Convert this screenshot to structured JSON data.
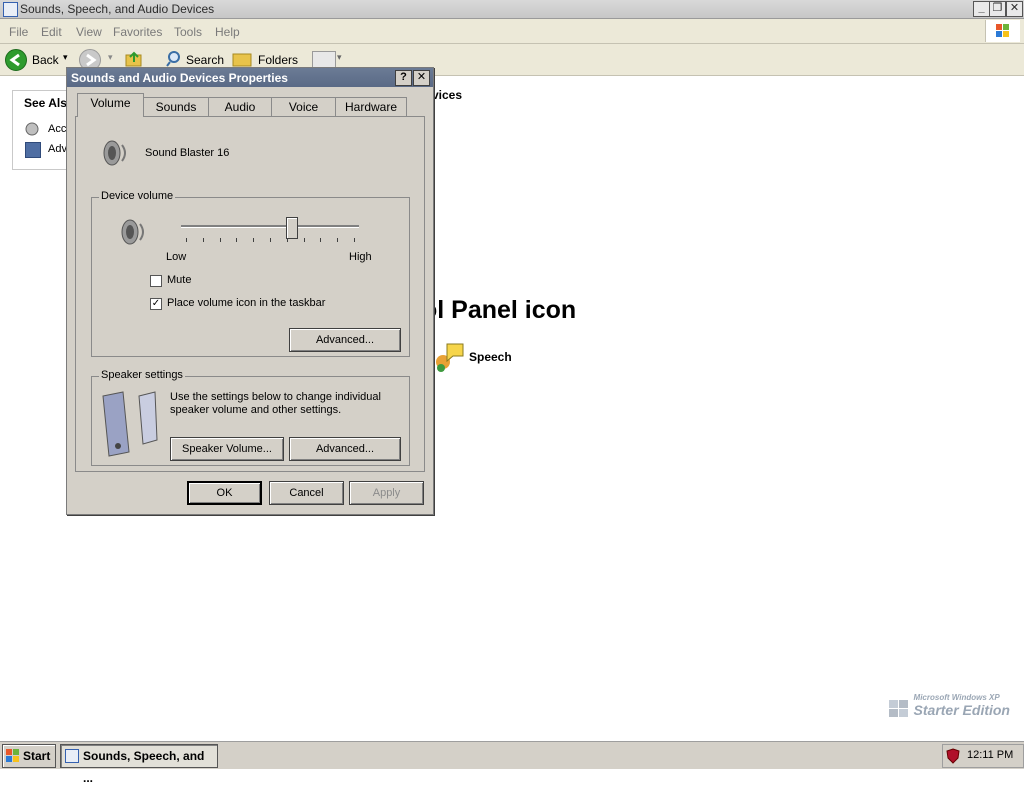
{
  "window": {
    "title": "Sounds, Speech, and Audio Devices",
    "controls": {
      "minimize": "_",
      "restore": "❐",
      "close": "✕"
    }
  },
  "menubar": [
    "File",
    "Edit",
    "View",
    "Favorites",
    "Tools",
    "Help"
  ],
  "toolbar": {
    "back": "Back",
    "search": "Search",
    "folders": "Folders"
  },
  "seealso": {
    "heading": "See Als",
    "items": [
      "Acc",
      "Adv"
    ]
  },
  "content": {
    "heading_fragment": "vices",
    "panel_icon_heading": "ol Panel icon",
    "speech_label": "Speech"
  },
  "dialog": {
    "title": "Sounds and Audio Devices Properties",
    "help": "?",
    "close": "✕",
    "tabs": [
      "Volume",
      "Sounds",
      "Audio",
      "Voice",
      "Hardware"
    ],
    "active_tab": "Volume",
    "device_name": "Sound Blaster 16",
    "device_volume": {
      "legend": "Device volume",
      "low": "Low",
      "high": "High",
      "level_fraction": 0.62,
      "mute_label": "Mute",
      "mute_checked": false,
      "taskbar_label": "Place volume icon in the taskbar",
      "taskbar_checked": true,
      "advanced": "Advanced..."
    },
    "speaker_settings": {
      "legend": "Speaker settings",
      "description": "Use the settings below to change individual speaker volume and other settings.",
      "speaker_volume": "Speaker Volume...",
      "advanced": "Advanced..."
    },
    "buttons": {
      "ok": "OK",
      "cancel": "Cancel",
      "apply": "Apply"
    }
  },
  "taskbar": {
    "start": "Start",
    "task": "Sounds, Speech, and ...",
    "clock": "12:11 PM"
  },
  "watermark": {
    "line1": "Microsoft Windows XP",
    "line2": "Starter Edition"
  },
  "colors": {
    "title_bg": "#6b7b95",
    "face": "#d4d0c8",
    "back_green": "#2e9b2e"
  }
}
